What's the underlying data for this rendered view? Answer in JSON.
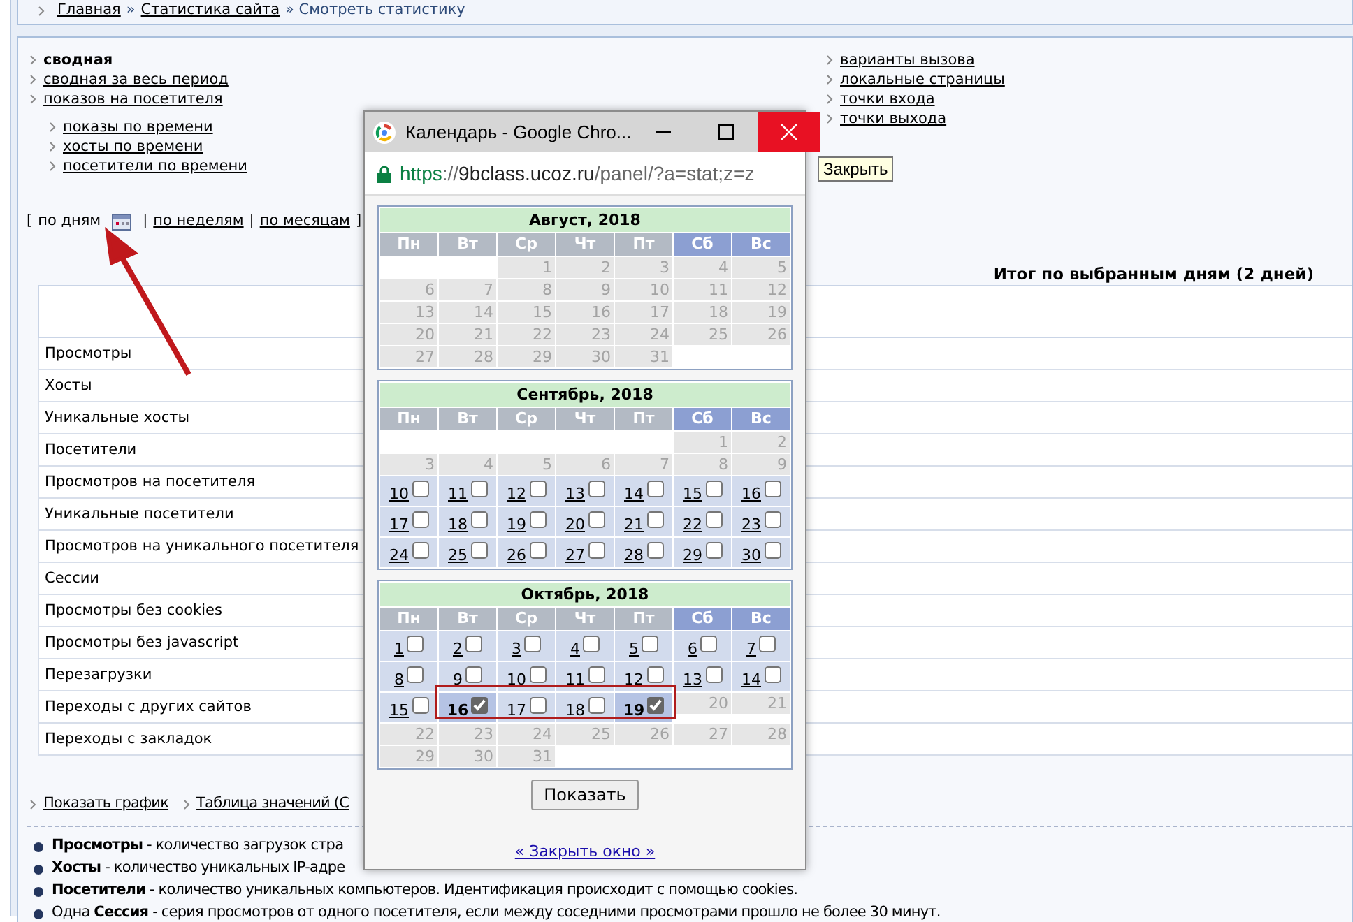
{
  "breadcrumb": [
    {
      "label": "Главная",
      "kind": "link"
    },
    {
      "label": "»",
      "kind": "sep"
    },
    {
      "label": "Статистика сайта",
      "kind": "link"
    },
    {
      "label": "» Смотреть статистику",
      "kind": "current"
    }
  ],
  "nav_left": [
    {
      "label": "сводная",
      "selected": true
    },
    {
      "label": "сводная за весь период",
      "selected": false
    },
    {
      "label": "показов на посетителя",
      "selected": false
    }
  ],
  "nav_sub": [
    {
      "label": "показы по времени",
      "selected": false
    },
    {
      "label": "хосты по времени",
      "selected": false
    },
    {
      "label": "посетители по времени",
      "selected": false
    }
  ],
  "nav_right": [
    {
      "label": "варианты вызова",
      "selected": false
    },
    {
      "label": "локальные страницы",
      "selected": false
    },
    {
      "label": "точки входа",
      "selected": false
    },
    {
      "label": "точки выхода",
      "selected": false
    }
  ],
  "period": [
    {
      "label": "[",
      "kind": "bracket"
    },
    {
      "label": "по дням",
      "kind": "option",
      "selected": true
    },
    {
      "label": "|",
      "kind": "sep"
    },
    {
      "label": "по неделям",
      "kind": "option",
      "selected": false
    },
    {
      "label": "|",
      "kind": "sep"
    },
    {
      "label": "по месяцам",
      "kind": "option",
      "selected": false
    },
    {
      "label": "]",
      "kind": "bracket"
    }
  ],
  "summary_title": "Итог по выбранным дням (2 дней)",
  "table": {
    "rows": [
      "Просмотры",
      "Хосты",
      "Уникальные хосты",
      "Посетители",
      "Просмотров на посетителя",
      "Уникальные посетители",
      "Просмотров на уникального посетителя",
      "Сессии",
      "Просмотры без cookies",
      "Просмотры без javascript",
      "Перезагрузки",
      "Переходы с других сайтов",
      "Переходы с закладок"
    ]
  },
  "bottom_links": [
    "Показать график",
    "Таблица значений (С"
  ],
  "legend": [
    "**Просмотры** - количество загрузок стра",
    "**Хосты** - количество уникальных IP-адре",
    "**Посетители** - количество уникальных компьютеров. Идентификация происходит с помощью cookies.",
    "Одна **Сессия** - серия просмотров от одного посетителя, если между соседними просмотрами прошло не более 30 минут."
  ],
  "popup": {
    "title": "Календарь - Google Chro...",
    "close_hover": true,
    "tooltip": "Закрыть",
    "url_parts": [
      {
        "text": "https",
        "kind": "secure"
      },
      {
        "text": "://",
        "kind": "dim"
      },
      {
        "text": "9bclass.ucoz.ru",
        "kind": "host"
      },
      {
        "text": "/panel/?a=stat;z=z",
        "kind": "dim"
      }
    ],
    "months": [
      {
        "title": "Август, 2018",
        "weekdays": [
          {
            "label": "Пн",
            "weekend": false
          },
          {
            "label": "Вт",
            "weekend": false
          },
          {
            "label": "Ср",
            "weekend": false
          },
          {
            "label": "Чт",
            "weekend": false
          },
          {
            "label": "Пт",
            "weekend": false
          },
          {
            "label": "Сб",
            "weekend": true
          },
          {
            "label": "Вс",
            "weekend": true
          }
        ],
        "weeks": [
          [
            {
              "kind": "blank"
            },
            {
              "kind": "blank"
            },
            {
              "label": "1",
              "kind": "past"
            },
            {
              "label": "2",
              "kind": "past"
            },
            {
              "label": "3",
              "kind": "past"
            },
            {
              "label": "4",
              "kind": "past"
            },
            {
              "label": "5",
              "kind": "past"
            }
          ],
          [
            {
              "label": "6",
              "kind": "past"
            },
            {
              "label": "7",
              "kind": "past"
            },
            {
              "label": "8",
              "kind": "past"
            },
            {
              "label": "9",
              "kind": "past"
            },
            {
              "label": "10",
              "kind": "past"
            },
            {
              "label": "11",
              "kind": "past"
            },
            {
              "label": "12",
              "kind": "past"
            }
          ],
          [
            {
              "label": "13",
              "kind": "past"
            },
            {
              "label": "14",
              "kind": "past"
            },
            {
              "label": "15",
              "kind": "past"
            },
            {
              "label": "16",
              "kind": "past"
            },
            {
              "label": "17",
              "kind": "past"
            },
            {
              "label": "18",
              "kind": "past"
            },
            {
              "label": "19",
              "kind": "past"
            }
          ],
          [
            {
              "label": "20",
              "kind": "past"
            },
            {
              "label": "21",
              "kind": "past"
            },
            {
              "label": "22",
              "kind": "past"
            },
            {
              "label": "23",
              "kind": "past"
            },
            {
              "label": "24",
              "kind": "past"
            },
            {
              "label": "25",
              "kind": "past"
            },
            {
              "label": "26",
              "kind": "past"
            }
          ],
          [
            {
              "label": "27",
              "kind": "past"
            },
            {
              "label": "28",
              "kind": "past"
            },
            {
              "label": "29",
              "kind": "past"
            },
            {
              "label": "30",
              "kind": "past"
            },
            {
              "label": "31",
              "kind": "past"
            },
            {
              "kind": "blank"
            },
            {
              "kind": "blank"
            }
          ]
        ]
      },
      {
        "title": "Сентябрь, 2018",
        "weekdays": [
          {
            "label": "Пн",
            "weekend": false
          },
          {
            "label": "Вт",
            "weekend": false
          },
          {
            "label": "Ср",
            "weekend": false
          },
          {
            "label": "Чт",
            "weekend": false
          },
          {
            "label": "Пт",
            "weekend": false
          },
          {
            "label": "Сб",
            "weekend": true
          },
          {
            "label": "Вс",
            "weekend": true
          }
        ],
        "weeks": [
          [
            {
              "kind": "blank"
            },
            {
              "kind": "blank"
            },
            {
              "kind": "blank"
            },
            {
              "kind": "blank"
            },
            {
              "kind": "blank"
            },
            {
              "label": "1",
              "kind": "past"
            },
            {
              "label": "2",
              "kind": "past"
            }
          ],
          [
            {
              "label": "3",
              "kind": "past"
            },
            {
              "label": "4",
              "kind": "past"
            },
            {
              "label": "5",
              "kind": "past"
            },
            {
              "label": "6",
              "kind": "past"
            },
            {
              "label": "7",
              "kind": "past"
            },
            {
              "label": "8",
              "kind": "past"
            },
            {
              "label": "9",
              "kind": "past"
            }
          ],
          [
            {
              "label": "10",
              "kind": "open",
              "checked": false
            },
            {
              "label": "11",
              "kind": "open",
              "checked": false
            },
            {
              "label": "12",
              "kind": "open",
              "checked": false
            },
            {
              "label": "13",
              "kind": "open",
              "checked": false
            },
            {
              "label": "14",
              "kind": "open",
              "checked": false
            },
            {
              "label": "15",
              "kind": "open",
              "checked": false
            },
            {
              "label": "16",
              "kind": "open",
              "checked": false
            }
          ],
          [
            {
              "label": "17",
              "kind": "open",
              "checked": false
            },
            {
              "label": "18",
              "kind": "open",
              "checked": false
            },
            {
              "label": "19",
              "kind": "open",
              "checked": false
            },
            {
              "label": "20",
              "kind": "open",
              "checked": false
            },
            {
              "label": "21",
              "kind": "open",
              "checked": false
            },
            {
              "label": "22",
              "kind": "open",
              "checked": false
            },
            {
              "label": "23",
              "kind": "open",
              "checked": false
            }
          ],
          [
            {
              "label": "24",
              "kind": "open",
              "checked": false
            },
            {
              "label": "25",
              "kind": "open",
              "checked": false
            },
            {
              "label": "26",
              "kind": "open",
              "checked": false
            },
            {
              "label": "27",
              "kind": "open",
              "checked": false
            },
            {
              "label": "28",
              "kind": "open",
              "checked": false
            },
            {
              "label": "29",
              "kind": "open",
              "checked": false
            },
            {
              "label": "30",
              "kind": "open",
              "checked": false
            }
          ]
        ]
      },
      {
        "title": "Октябрь, 2018",
        "weekdays": [
          {
            "label": "Пн",
            "weekend": false
          },
          {
            "label": "Вт",
            "weekend": false
          },
          {
            "label": "Ср",
            "weekend": false
          },
          {
            "label": "Чт",
            "weekend": false
          },
          {
            "label": "Пт",
            "weekend": false
          },
          {
            "label": "Сб",
            "weekend": true
          },
          {
            "label": "Вс",
            "weekend": true
          }
        ],
        "highlight": true,
        "weeks": [
          [
            {
              "label": "1",
              "kind": "open",
              "checked": false
            },
            {
              "label": "2",
              "kind": "open",
              "checked": false
            },
            {
              "label": "3",
              "kind": "open",
              "checked": false
            },
            {
              "label": "4",
              "kind": "open",
              "checked": false
            },
            {
              "label": "5",
              "kind": "open",
              "checked": false
            },
            {
              "label": "6",
              "kind": "open",
              "checked": false
            },
            {
              "label": "7",
              "kind": "open",
              "checked": false
            }
          ],
          [
            {
              "label": "8",
              "kind": "open",
              "checked": false
            },
            {
              "label": "9",
              "kind": "open",
              "checked": false
            },
            {
              "label": "10",
              "kind": "open",
              "checked": false
            },
            {
              "label": "11",
              "kind": "open",
              "checked": false
            },
            {
              "label": "12",
              "kind": "open",
              "checked": false
            },
            {
              "label": "13",
              "kind": "open",
              "checked": false
            },
            {
              "label": "14",
              "kind": "open",
              "checked": false
            }
          ],
          [
            {
              "label": "15",
              "kind": "open",
              "checked": false
            },
            {
              "label": "16",
              "kind": "open",
              "checked": true
            },
            {
              "label": "17",
              "kind": "open",
              "checked": false
            },
            {
              "label": "18",
              "kind": "open",
              "checked": false
            },
            {
              "label": "19",
              "kind": "open",
              "checked": true
            },
            {
              "label": "20",
              "kind": "past"
            },
            {
              "label": "21",
              "kind": "past"
            }
          ],
          [
            {
              "label": "22",
              "kind": "past"
            },
            {
              "label": "23",
              "kind": "past"
            },
            {
              "label": "24",
              "kind": "past"
            },
            {
              "label": "25",
              "kind": "past"
            },
            {
              "label": "26",
              "kind": "past"
            },
            {
              "label": "27",
              "kind": "past"
            },
            {
              "label": "28",
              "kind": "past"
            }
          ],
          [
            {
              "label": "29",
              "kind": "past"
            },
            {
              "label": "30",
              "kind": "past"
            },
            {
              "label": "31",
              "kind": "past"
            },
            {
              "kind": "blank"
            },
            {
              "kind": "blank"
            },
            {
              "kind": "blank"
            },
            {
              "kind": "blank"
            }
          ]
        ]
      }
    ],
    "button": "Показать",
    "close_link": "« Закрыть окно »"
  }
}
